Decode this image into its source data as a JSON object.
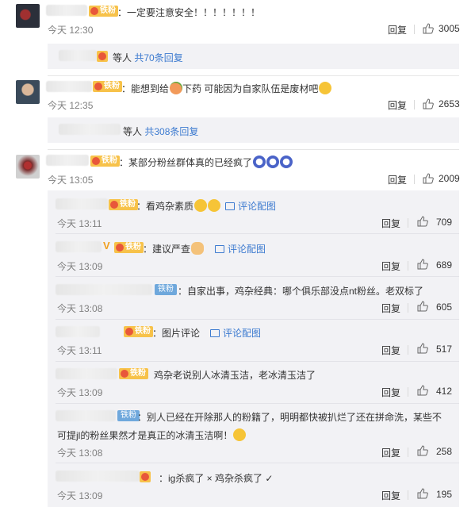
{
  "comments": [
    {
      "text": "：一定要注意安全！！！！！！！",
      "time": "今天 12:30",
      "reply": "回复",
      "likes": "3005"
    },
    {
      "text": "：能想到给",
      "text2": "下药  可能因为自家队伍是废材吧",
      "time": "今天 12:35",
      "reply": "回复",
      "likes": "2653"
    },
    {
      "text": "：某部分粉丝群体真的已经疯了",
      "time": "今天 13:05",
      "reply": "回复",
      "likes": "2009"
    }
  ],
  "summaries": [
    {
      "prefix": "等人 ",
      "link": "共70条回复"
    },
    {
      "prefix": "等人 ",
      "link": "共308条回复"
    }
  ],
  "replies": [
    {
      "text": "：看鸡杂素质",
      "pic": "评论配图",
      "time": "今天 13:11",
      "reply": "回复",
      "likes": "709"
    },
    {
      "text": "：建议严查",
      "pic": "评论配图",
      "time": "今天 13:09",
      "reply": "回复",
      "likes": "689"
    },
    {
      "text": "：自家出事，鸡杂经典：哪个俱乐部没点nt粉丝。老双标了",
      "time": "今天 13:08",
      "reply": "回复",
      "likes": "605"
    },
    {
      "text": "：图片评论",
      "pic": "评论配图",
      "time": "今天 13:11",
      "reply": "回复",
      "likes": "517"
    },
    {
      "text": "鸡杂老说别人冰清玉洁，老冰清玉洁了",
      "time": "今天 13:09",
      "reply": "回复",
      "likes": "412"
    },
    {
      "text": "：别人已经在开除那人的粉籍了，明明都快被扒烂了还在拼命洗，某些不",
      "text2": "可提jl的粉丝果然才是真正的冰清玉洁啊！",
      "time": "今天 13:08",
      "reply": "回复",
      "likes": "258"
    },
    {
      "text": "：ig杀疯了 × 鸡杂杀疯了 ✓",
      "time": "今天 13:09",
      "reply": "回复",
      "likes": "195"
    }
  ],
  "badges": {
    "tie": "铁粉"
  },
  "colors": {
    "link": "#3d7bd0",
    "badge_gold": "#f7c24a",
    "badge_blue": "#6fa8dc",
    "sub_bg": "#f2f2f5"
  }
}
